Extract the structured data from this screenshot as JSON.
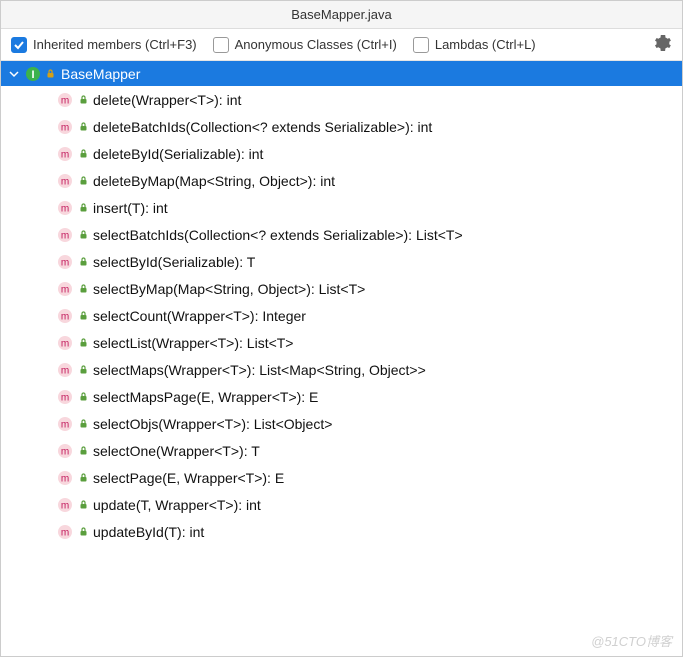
{
  "title": "BaseMapper.java",
  "toolbar": {
    "inherited": {
      "label": "Inherited members (Ctrl+F3)",
      "checked": true
    },
    "anonymous": {
      "label": "Anonymous Classes (Ctrl+I)",
      "checked": false
    },
    "lambdas": {
      "label": "Lambdas (Ctrl+L)",
      "checked": false
    }
  },
  "root": {
    "label": "BaseMapper"
  },
  "methods": [
    {
      "label": "delete(Wrapper<T>): int"
    },
    {
      "label": "deleteBatchIds(Collection<? extends Serializable>): int"
    },
    {
      "label": "deleteById(Serializable): int"
    },
    {
      "label": "deleteByMap(Map<String, Object>): int"
    },
    {
      "label": "insert(T): int"
    },
    {
      "label": "selectBatchIds(Collection<? extends Serializable>): List<T>"
    },
    {
      "label": "selectById(Serializable): T"
    },
    {
      "label": "selectByMap(Map<String, Object>): List<T>"
    },
    {
      "label": "selectCount(Wrapper<T>): Integer"
    },
    {
      "label": "selectList(Wrapper<T>): List<T>"
    },
    {
      "label": "selectMaps(Wrapper<T>): List<Map<String, Object>>"
    },
    {
      "label": "selectMapsPage(E, Wrapper<T>): E"
    },
    {
      "label": "selectObjs(Wrapper<T>): List<Object>"
    },
    {
      "label": "selectOne(Wrapper<T>): T"
    },
    {
      "label": "selectPage(E, Wrapper<T>): E"
    },
    {
      "label": "update(T, Wrapper<T>): int"
    },
    {
      "label": "updateById(T): int"
    }
  ],
  "watermark": "@51CTO博客"
}
